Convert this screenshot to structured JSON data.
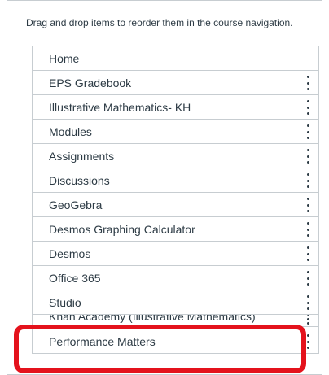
{
  "instructions": "Drag and drop items to reorder them in the course navigation.",
  "nav_items": [
    {
      "label": "Home"
    },
    {
      "label": "EPS Gradebook"
    },
    {
      "label": "Illustrative Mathematics- KH"
    },
    {
      "label": "Modules"
    },
    {
      "label": "Assignments"
    },
    {
      "label": "Discussions"
    },
    {
      "label": "GeoGebra"
    },
    {
      "label": "Desmos Graphing Calculator"
    },
    {
      "label": "Desmos"
    },
    {
      "label": "Office 365"
    },
    {
      "label": "Studio"
    },
    {
      "label": "Khan Academy (Illustrative Mathematics)"
    },
    {
      "label": "Performance Matters"
    }
  ],
  "icons": {
    "options": "kebab-menu-icon"
  },
  "colors": {
    "text": "#2d3b45",
    "border": "#c7cdd1",
    "highlight": "#e4121c"
  }
}
